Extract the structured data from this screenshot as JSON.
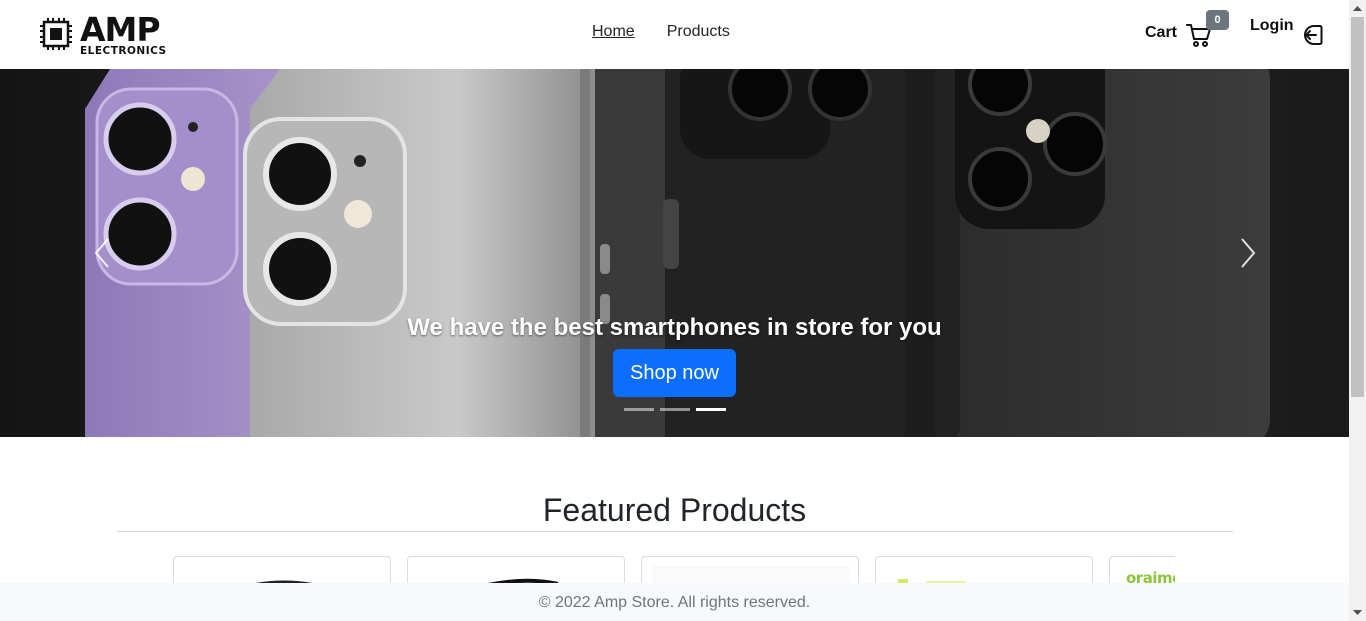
{
  "brand": {
    "logo_main": "AMP",
    "logo_sub": "ELECTRONICS"
  },
  "nav": {
    "links": [
      {
        "label": "Home",
        "active": true
      },
      {
        "label": "Products",
        "active": false
      }
    ],
    "cart_label": "Cart",
    "cart_count": "0",
    "login_label": "Login"
  },
  "hero": {
    "caption": "We have the best smartphones in store for you",
    "button_label": "Shop now",
    "slides": 3,
    "active_slide": 3
  },
  "featured": {
    "title": "Featured Products",
    "brand_peek": "oraimo"
  },
  "footer": {
    "text": "© 2022 Amp Store. All rights reserved."
  },
  "colors": {
    "primary": "#0d6efd",
    "badge": "#6c757d",
    "footer_bg": "#f8f9fa",
    "brand_green": "#8cc63f"
  }
}
